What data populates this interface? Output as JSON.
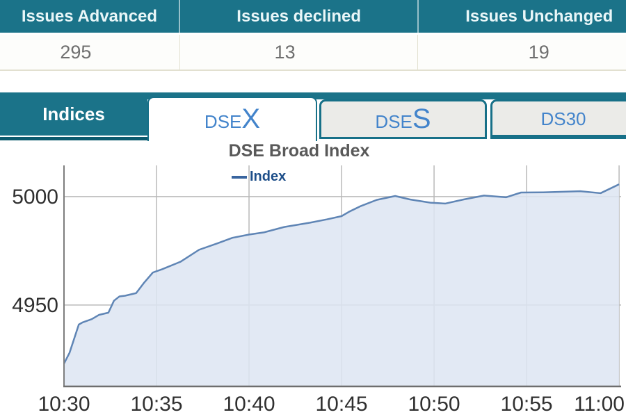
{
  "summary_table": {
    "columns": [
      {
        "header": "Issues Advanced",
        "value": "295"
      },
      {
        "header": "Issues declined",
        "value": "13"
      },
      {
        "header": "Issues Unchanged",
        "value": "19"
      }
    ]
  },
  "indices_panel": {
    "title": "Indices",
    "tabs": [
      {
        "id": "dsex",
        "prefix": "DSE",
        "suffix": "X",
        "active": true
      },
      {
        "id": "dses",
        "prefix": "DSE",
        "suffix": "S",
        "active": false
      },
      {
        "id": "ds30",
        "prefix": "DS30",
        "suffix": "",
        "active": false
      }
    ]
  },
  "chart_data": {
    "type": "area",
    "title": "DSE Broad Index",
    "legend": [
      {
        "label": "Index",
        "color": "#39659f"
      }
    ],
    "xlabel": "",
    "ylabel": "",
    "x_tick_minutes": [
      0,
      5,
      10,
      15,
      20,
      25,
      30
    ],
    "x_tick_labels": [
      "10:30",
      "10:35",
      "10:40",
      "10:45",
      "10:50",
      "10:55",
      "11:00"
    ],
    "y_ticks": [
      5000,
      4950
    ],
    "xlim_minutes": [
      0,
      30.11
    ],
    "ylim": [
      4912.8,
      5014.4
    ],
    "grid": true,
    "legend_position": "top-center",
    "series": [
      {
        "name": "Index",
        "x_minutes_after_1030": [
          0,
          0.3,
          0.8,
          1.0,
          1.5,
          1.9,
          2.4,
          2.7,
          3.0,
          3.3,
          3.9,
          4.3,
          4.8,
          5.3,
          6.3,
          7.3,
          8.3,
          9.1,
          10.0,
          10.8,
          11.9,
          13.3,
          14.2,
          15.0,
          15.4,
          16.0,
          16.9,
          17.9,
          18.7,
          19.8,
          20.6,
          21.6,
          22.7,
          23.9,
          24.7,
          25.9,
          27.9,
          29.0,
          30.0
        ],
        "values": [
          4923,
          4928,
          4941,
          4942,
          4943.5,
          4945.5,
          4946.5,
          4952,
          4954,
          4954.3,
          4955.5,
          4960,
          4965,
          4966.5,
          4970,
          4975.5,
          4978.5,
          4981,
          4982.5,
          4983.5,
          4986,
          4988,
          4989.5,
          4991,
          4993,
          4995.5,
          4998.5,
          5000.3,
          4998.7,
          4997.2,
          4996.8,
          4998.7,
          5000.5,
          4999.7,
          5001.9,
          5002,
          5002.5,
          5001.6,
          5005.7
        ]
      }
    ],
    "colors": {
      "line": "#5f85b5",
      "fill": "#dde5f2",
      "grid": "#b9b9b9",
      "axis": "#7d7d7d",
      "tick_text": "#303030"
    }
  },
  "theme": {
    "teal": "#1b7389",
    "teal_dark": "#0d5a6e",
    "tab_text_blue": "#4384cb"
  }
}
